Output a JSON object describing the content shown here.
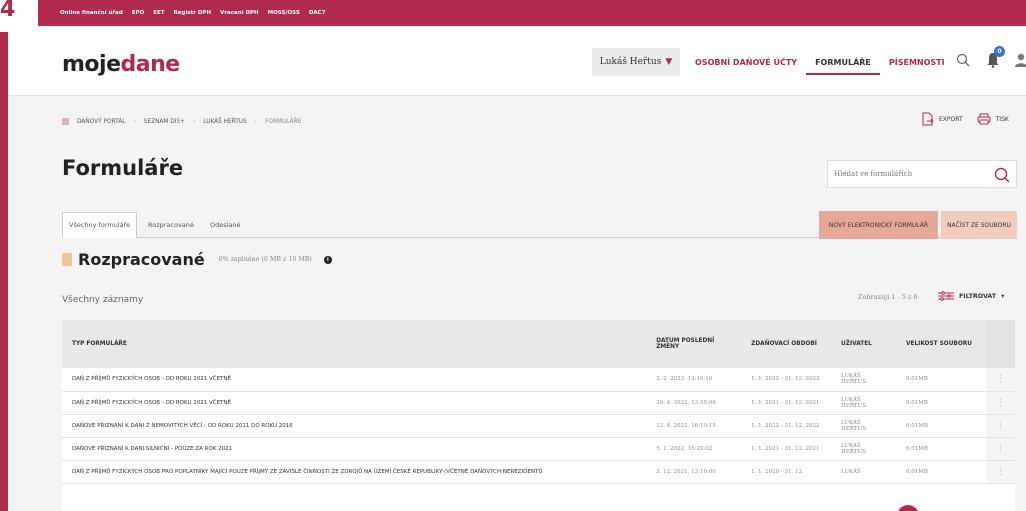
{
  "corner_number": "4",
  "topbar": {
    "links": [
      "Online finanční úřad",
      "EPO",
      "EET",
      "Registr DPH",
      "Vracení DPH",
      "MOSS/OSS",
      "DAC7"
    ]
  },
  "header": {
    "logo_part1": "moje",
    "logo_part2": "dane",
    "user": "Lukáš Heřtus",
    "nav": [
      "OSOBNÍ DAŇOVÉ ÚČTY",
      "FORMULÁŘE",
      "PÍSEMNOSTI"
    ],
    "nav_active_index": 1,
    "notification_count": "0"
  },
  "breadcrumb": {
    "items": [
      "DAŇOVÝ PORTÁL",
      "SEZNAM DIS+",
      "LUKÁŠ HEŘTUS",
      "FORMULÁŘE"
    ]
  },
  "tools": {
    "export": "EXPORT",
    "print": "TISK"
  },
  "page_title": "Formuláře",
  "search": {
    "placeholder": "Hledat ve formulářích"
  },
  "tabs": [
    "Všechny formuláře",
    "Rozpracované",
    "Odeslané"
  ],
  "buttons": {
    "new_form": "NOVÝ ELEKTRONICKÝ FORMULÁŘ",
    "load_file": "NAČÍST ZE SOUBORU"
  },
  "section": {
    "title": "Rozpracované",
    "usage": "0% zaplněno (0 MB z 10 MB)"
  },
  "records_label": "Všechny záznamy",
  "showing": "Zobrazuji 1 - 5 z 6",
  "filter_label": "FILTROVAT",
  "table": {
    "headers": [
      "TYP FORMULÁŘE",
      "DATUM POSLEDNÍ ZMĚNY",
      "ZDAŇOVACÍ OBDOBÍ",
      "UŽIVATEL",
      "VELIKOST SOUBORU"
    ],
    "rows": [
      [
        "DAŇ Z PŘÍJMŮ FYZICKÝCH OSOB - OD ROKU 2021 VČETNĚ",
        "2. 2. 2023, 13:10:16",
        "1. 1. 2022 - 31. 12. 2022",
        "LUKÁŠ HEŘTUS",
        "0.01MB"
      ],
      [
        "DAŇ Z PŘÍJMŮ FYZICKÝCH OSOB - OD ROKU 2021 VČETNĚ",
        "29. 4. 2022, 13:55:06",
        "1. 1. 2021 - 31. 12. 2021",
        "LUKÁŠ HEŘTUS",
        "0.01MB"
      ],
      [
        "DAŇOVÉ PŘIZNÁNÍ K DANI Z NEMOVITÝCH VĚCÍ - OD ROKU 2011 DO ROKU 2016",
        "12. 4. 2022, 16:10:15",
        "1. 1. 2022 - 31. 12. 2022",
        "LUKÁŠ HEŘTUS",
        "0.01MB"
      ],
      [
        "DAŇOVÉ PŘIZNÁNÍ K DANI SILNIČNÍ - POUZE ZA ROK 2021",
        "5. 1. 2022, 16:25:02",
        "1. 1. 2021 - 31. 12. 2021",
        "LUKÁŠ HEŘTUS",
        "0.01MB"
      ],
      [
        "DAŇ Z PŘÍJMŮ FYZICKÝCH OSOB PRO POPLATNÍKY MAJÍCÍ POUZE PŘÍJMY ZE ZÁVISLÉ ČINNOSTI ZE ZDROJŮ NA ÚZEMÍ ČESKÉ REPUBLIKY (VČETNĚ DAŇOVÝCH NEREZIDENTŮ",
        "3. 12. 2021, 13:10:00",
        "1. 1. 2020 - 31. 12.",
        "LUKÁŠ",
        "0.01MB"
      ]
    ]
  },
  "colors": {
    "brand": "#b02a4d",
    "badge": "#3c6fd1",
    "button_primary": "#e7a898",
    "button_secondary": "#f2cbbf"
  }
}
